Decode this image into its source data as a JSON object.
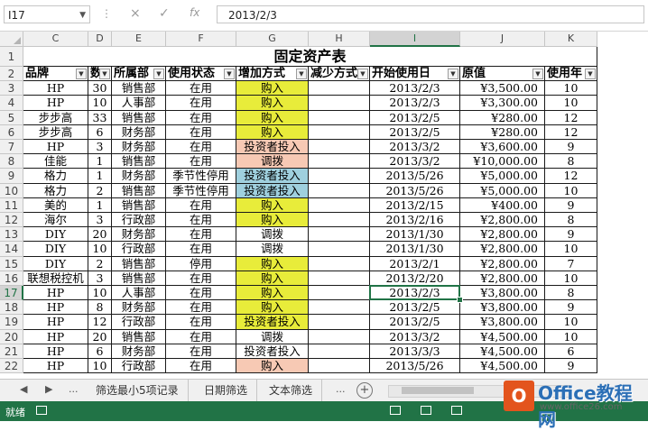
{
  "formula_bar": {
    "name_box": "I17",
    "cancel_icon": "×",
    "enter_icon": "✓",
    "fx_icon": "fx",
    "value": "2013/2/3"
  },
  "column_headers": [
    "C",
    "D",
    "E",
    "F",
    "G",
    "H",
    "I",
    "J",
    "K"
  ],
  "selected_column": "I",
  "selected_row": "17",
  "title": "固定资产表",
  "headers": [
    "品牌",
    "数",
    "所属部",
    "使用状态",
    "增加方式",
    "减少方式",
    "开始使用日",
    "原值",
    "使用年"
  ],
  "rows": [
    {
      "n": "3",
      "c": [
        "HP",
        "30",
        "销售部",
        "在用",
        "购入",
        "",
        "2013/2/3",
        "¥3,500.00",
        "10"
      ],
      "fill": "yellow"
    },
    {
      "n": "4",
      "c": [
        "HP",
        "10",
        "人事部",
        "在用",
        "购入",
        "",
        "2013/2/3",
        "¥3,300.00",
        "10"
      ],
      "fill": "yellow"
    },
    {
      "n": "5",
      "c": [
        "步步高",
        "33",
        "销售部",
        "在用",
        "购入",
        "",
        "2013/2/5",
        "¥280.00",
        "12"
      ],
      "fill": "yellow"
    },
    {
      "n": "6",
      "c": [
        "步步高",
        "6",
        "财务部",
        "在用",
        "购入",
        "",
        "2013/2/5",
        "¥280.00",
        "12"
      ],
      "fill": "yellow"
    },
    {
      "n": "7",
      "c": [
        "HP",
        "3",
        "财务部",
        "在用",
        "投资者投入",
        "",
        "2013/3/2",
        "¥3,600.00",
        "9"
      ],
      "fill": "pink"
    },
    {
      "n": "8",
      "c": [
        "佳能",
        "1",
        "销售部",
        "在用",
        "调拨",
        "",
        "2013/3/2",
        "¥10,000.00",
        "8"
      ],
      "fill": "pink"
    },
    {
      "n": "9",
      "c": [
        "格力",
        "1",
        "财务部",
        "季节性停用",
        "投资者投入",
        "",
        "2013/5/26",
        "¥5,000.00",
        "12"
      ],
      "fill": "blue"
    },
    {
      "n": "10",
      "c": [
        "格力",
        "2",
        "销售部",
        "季节性停用",
        "投资者投入",
        "",
        "2013/5/26",
        "¥5,000.00",
        "10"
      ],
      "fill": "blue"
    },
    {
      "n": "11",
      "c": [
        "美的",
        "1",
        "销售部",
        "在用",
        "购入",
        "",
        "2013/2/15",
        "¥400.00",
        "9"
      ],
      "fill": "yellow"
    },
    {
      "n": "12",
      "c": [
        "海尔",
        "3",
        "行政部",
        "在用",
        "购入",
        "",
        "2013/2/16",
        "¥2,800.00",
        "8"
      ],
      "fill": "yellow"
    },
    {
      "n": "13",
      "c": [
        "DIY",
        "20",
        "财务部",
        "在用",
        "调拨",
        "",
        "2013/1/30",
        "¥2,800.00",
        "9"
      ],
      "fill": "none"
    },
    {
      "n": "14",
      "c": [
        "DIY",
        "10",
        "行政部",
        "在用",
        "调拨",
        "",
        "2013/1/30",
        "¥2,800.00",
        "10"
      ],
      "fill": "none"
    },
    {
      "n": "15",
      "c": [
        "DIY",
        "2",
        "销售部",
        "停用",
        "购入",
        "",
        "2013/2/1",
        "¥2,800.00",
        "7"
      ],
      "fill": "yellow"
    },
    {
      "n": "16",
      "c": [
        "联想税控机",
        "3",
        "销售部",
        "在用",
        "购入",
        "",
        "2013/2/20",
        "¥2,800.00",
        "10"
      ],
      "fill": "yellow"
    },
    {
      "n": "17",
      "c": [
        "HP",
        "10",
        "人事部",
        "在用",
        "购入",
        "",
        "2013/2/3",
        "¥3,800.00",
        "8"
      ],
      "fill": "yellow"
    },
    {
      "n": "18",
      "c": [
        "HP",
        "8",
        "财务部",
        "在用",
        "购入",
        "",
        "2013/2/5",
        "¥3,800.00",
        "9"
      ],
      "fill": "yellow"
    },
    {
      "n": "19",
      "c": [
        "HP",
        "12",
        "行政部",
        "在用",
        "投资者投入",
        "",
        "2013/2/5",
        "¥3,800.00",
        "10"
      ],
      "fill": "yellow"
    },
    {
      "n": "20",
      "c": [
        "HP",
        "20",
        "销售部",
        "在用",
        "调拨",
        "",
        "2013/3/2",
        "¥4,500.00",
        "10"
      ],
      "fill": "none"
    },
    {
      "n": "21",
      "c": [
        "HP",
        "6",
        "财务部",
        "在用",
        "投资者投入",
        "",
        "2013/3/3",
        "¥4,500.00",
        "6"
      ],
      "fill": "none"
    },
    {
      "n": "22",
      "c": [
        "HP",
        "10",
        "行政部",
        "在用",
        "购入",
        "",
        "2013/5/26",
        "¥4,500.00",
        "9"
      ],
      "fill": "pink"
    }
  ],
  "tabs": {
    "prev": "◀",
    "next": "▶",
    "more_left": "...",
    "items": [
      "筛选最小5项记录",
      "日期筛选",
      "文本筛选"
    ],
    "more_right": "...",
    "add": "+"
  },
  "status": {
    "text": "就绪"
  },
  "watermark": {
    "logo_letter": "O",
    "title": "Office教程网",
    "url": "www.office26.com"
  },
  "colors": {
    "yellow": "#e8ec3a",
    "pink": "#f7c9b4",
    "blue": "#9fd0de",
    "accent": "#217346"
  }
}
